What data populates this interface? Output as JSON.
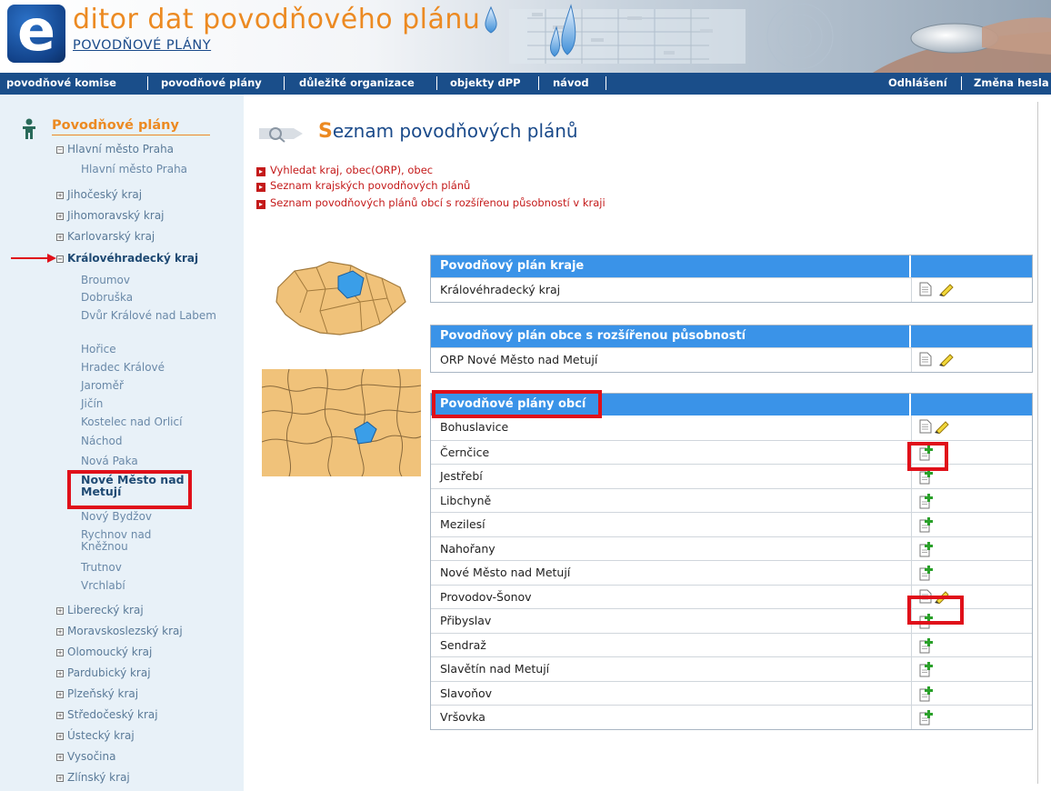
{
  "app": {
    "title": "ditor dat povodňového plánu",
    "subtitle": "POVODŇOVÉ PLÁNY",
    "logo_letter": "e"
  },
  "nav": {
    "left": [
      "povodňové komise",
      "povodňové plány",
      "důležité organizace",
      "objekty dPP",
      "návod"
    ],
    "right": [
      "Odhlášení",
      "Změna hesla"
    ]
  },
  "sidebar": {
    "title": "Povodňové plány",
    "regions": [
      {
        "label": "Hlavní město Praha",
        "expanded": true,
        "children": [
          "Hlavní město Praha"
        ]
      },
      {
        "label": "Jihočeský kraj",
        "expanded": false
      },
      {
        "label": "Jihomoravský kraj",
        "expanded": false
      },
      {
        "label": "Karlovarský kraj",
        "expanded": false
      },
      {
        "label": "Královéhradecký kraj",
        "expanded": true,
        "children": [
          "Broumov",
          "Dobruška",
          "Dvůr Králové nad Labem",
          "Hořice",
          "Hradec Králové",
          "Jaroměř",
          "Jičín",
          "Kostelec nad Orlicí",
          "Náchod",
          "Nová Paka",
          "Nové Město nad Metují",
          "Nový Bydžov",
          "Rychnov nad Kněžnou",
          "Trutnov",
          "Vrchlabí"
        ]
      },
      {
        "label": "Liberecký kraj",
        "expanded": false
      },
      {
        "label": "Moravskoslezský kraj",
        "expanded": false
      },
      {
        "label": "Olomoucký kraj",
        "expanded": false
      },
      {
        "label": "Pardubický kraj",
        "expanded": false
      },
      {
        "label": "Plzeňský kraj",
        "expanded": false
      },
      {
        "label": "Středočeský kraj",
        "expanded": false
      },
      {
        "label": "Ústecký kraj",
        "expanded": false
      },
      {
        "label": "Vysočina",
        "expanded": false
      },
      {
        "label": "Zlínský kraj",
        "expanded": false
      }
    ],
    "active_child": "Nové Město nad Metují"
  },
  "main": {
    "title_cap": "S",
    "title_rest": "eznam povodňových plánů",
    "links": [
      "Vyhledat kraj, obec(ORP), obec",
      "Seznam krajských povodňových plánů",
      "Seznam povodňových plánů obcí s rozšířenou působností v kraji"
    ],
    "table_region": {
      "header": "Povodňový plán kraje",
      "rows": [
        {
          "name": "Královéhradecký kraj",
          "state": "edit"
        }
      ]
    },
    "table_orp": {
      "header": "Povodňový plán obce s rozšířenou působností",
      "rows": [
        {
          "name": "ORP Nové Město nad Metují",
          "state": "edit"
        }
      ]
    },
    "table_obce": {
      "header": "Povodňové plány obcí",
      "rows": [
        {
          "name": "Bohuslavice",
          "state": "edit"
        },
        {
          "name": "Černčice",
          "state": "add"
        },
        {
          "name": "Jestřebí",
          "state": "add"
        },
        {
          "name": "Libchyně",
          "state": "add"
        },
        {
          "name": "Mezilesí",
          "state": "add"
        },
        {
          "name": "Nahořany",
          "state": "add"
        },
        {
          "name": "Nové Město nad Metují",
          "state": "add"
        },
        {
          "name": "Provodov-Šonov",
          "state": "edit"
        },
        {
          "name": "Přibyslav",
          "state": "add"
        },
        {
          "name": "Sendraž",
          "state": "add"
        },
        {
          "name": "Slavětín nad Metují",
          "state": "add"
        },
        {
          "name": "Slavoňov",
          "state": "add"
        },
        {
          "name": "Vršovka",
          "state": "add"
        }
      ]
    }
  },
  "colors": {
    "accent_orange": "#ec8a22",
    "nav_blue": "#1a4e8a",
    "table_header_blue": "#3a93e8",
    "link_red": "#c41a1a",
    "highlight_red": "#e0101a"
  },
  "icons": {
    "person": "person-icon",
    "document": "document-icon",
    "pencil": "pencil-icon",
    "add": "add-document-icon",
    "arrow": "arrow-right-icon"
  }
}
